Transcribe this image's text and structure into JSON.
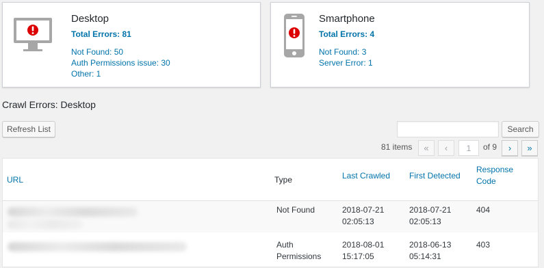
{
  "cards": {
    "desktop": {
      "title": "Desktop",
      "total": "Total Errors: 81",
      "lines": [
        "Not Found: 50",
        "Auth Permissions issue: 30",
        "Other: 1"
      ],
      "icon": "desktop-monitor-icon"
    },
    "smartphone": {
      "title": "Smartphone",
      "total": "Total Errors: 4",
      "lines": [
        "Not Found: 3",
        "Server Error: 1"
      ],
      "icon": "smartphone-icon"
    },
    "alert_color": "#dc0000"
  },
  "section_title": "Crawl Errors: Desktop",
  "toolbar": {
    "refresh_label": "Refresh List",
    "search_value": "",
    "search_label": "Search"
  },
  "pagination": {
    "items": "81 items",
    "first": "«",
    "prev": "‹",
    "current": "1",
    "of": "of 9",
    "next": "›",
    "last": "»"
  },
  "table": {
    "columns": [
      "URL",
      "Type",
      "Last Crawled",
      "First Detected",
      "Response Code"
    ],
    "rows": [
      {
        "url": "",
        "type": "Not Found",
        "last_crawled": [
          "2018-07-21",
          "02:05:13"
        ],
        "first_detected": [
          "2018-07-21",
          "02:05:13"
        ],
        "code": "404"
      },
      {
        "url": "",
        "type": [
          "Auth",
          "Permissions"
        ],
        "last_crawled": [
          "2018-08-01",
          "15:17:05"
        ],
        "first_detected": [
          "2018-06-13",
          "05:14:31"
        ],
        "code": "403"
      }
    ]
  }
}
